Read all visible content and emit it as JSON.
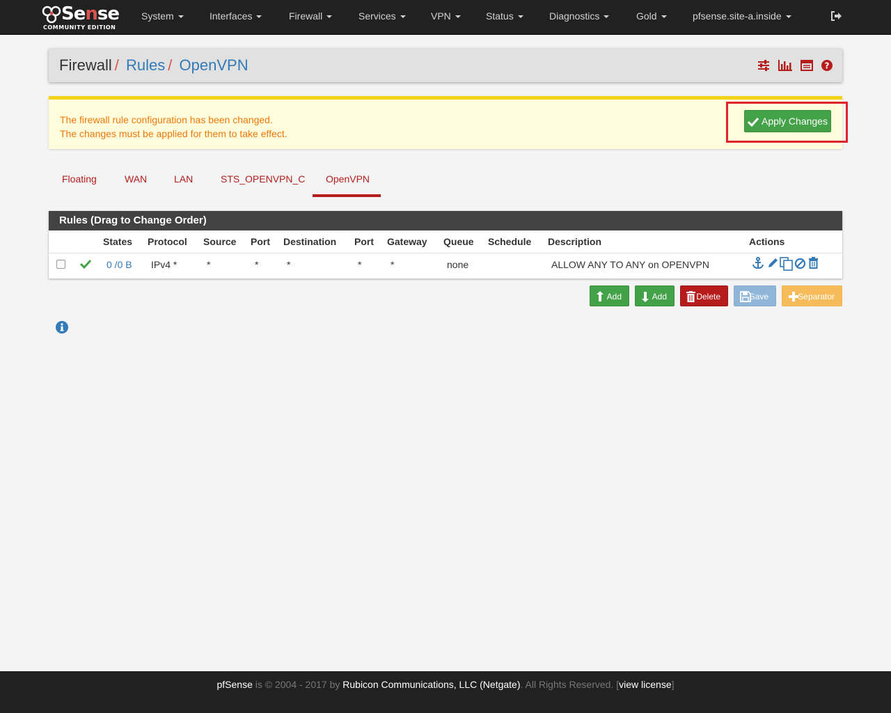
{
  "navbar": {
    "logo": {
      "word": "Sense",
      "prefix": "pf",
      "edition": "COMMUNITY EDITION"
    },
    "menu": [
      {
        "label": "System"
      },
      {
        "label": "Interfaces"
      },
      {
        "label": "Firewall"
      },
      {
        "label": "Services"
      },
      {
        "label": "VPN"
      },
      {
        "label": "Status"
      },
      {
        "label": "Diagnostics"
      },
      {
        "label": "Gold"
      },
      {
        "label": "pfsense.site-a.inside"
      }
    ],
    "logout_icon": "sign-out-icon"
  },
  "breadcrumb": {
    "items": [
      "Firewall",
      "Rules",
      "OpenVPN"
    ],
    "separator": "/",
    "icons": [
      "sliders-icon",
      "bar-chart-icon",
      "table-list-icon",
      "question-circle-icon"
    ]
  },
  "alert": {
    "line1": "The firewall rule configuration has been changed.",
    "line2": "The changes must be applied for them to take effect.",
    "apply_label": "Apply Changes",
    "apply_icon": "check-icon"
  },
  "tabs": [
    {
      "label": "Floating"
    },
    {
      "label": "WAN"
    },
    {
      "label": "LAN"
    },
    {
      "label": "STS_OPENVPN_C"
    },
    {
      "label": "OpenVPN",
      "active": true
    }
  ],
  "rules": {
    "title": "Rules (Drag to Change Order)",
    "columns": [
      "States",
      "Protocol",
      "Source",
      "Port",
      "Destination",
      "Port",
      "Gateway",
      "Queue",
      "Schedule",
      "Description",
      "Actions"
    ],
    "rows": [
      {
        "enabled_icon": "check-icon",
        "states": "0 /0 B",
        "protocol": "IPv4 *",
        "source": "*",
        "source_port": "*",
        "destination": "*",
        "destination_port": "*",
        "gateway": "*",
        "queue": "none",
        "schedule": "",
        "description": "ALLOW ANY TO ANY on OPENVPN",
        "actions": [
          "anchor-icon",
          "pencil-icon",
          "copy-icon",
          "ban-icon",
          "trash-icon"
        ]
      }
    ]
  },
  "buttons": {
    "add_top": "Add",
    "add_bottom": "Add",
    "delete": "Delete",
    "save": "Save",
    "separator": "Separator"
  },
  "info_icon": "info-circle-icon",
  "footer": {
    "brand": "pfSense",
    "is": " is © 2004 - 2017 by ",
    "company": "Rubicon Communications, LLC (Netgate)",
    "rights": ". All Rights Reserved. [",
    "license": "view license",
    "close": "]"
  },
  "colors": {
    "navbar": "#212121",
    "accent_red": "#b51c1c",
    "link_blue": "#337ab7",
    "success_green": "#43a247",
    "alert_text": "#f0780a",
    "alert_bg": "#fffcdc"
  }
}
